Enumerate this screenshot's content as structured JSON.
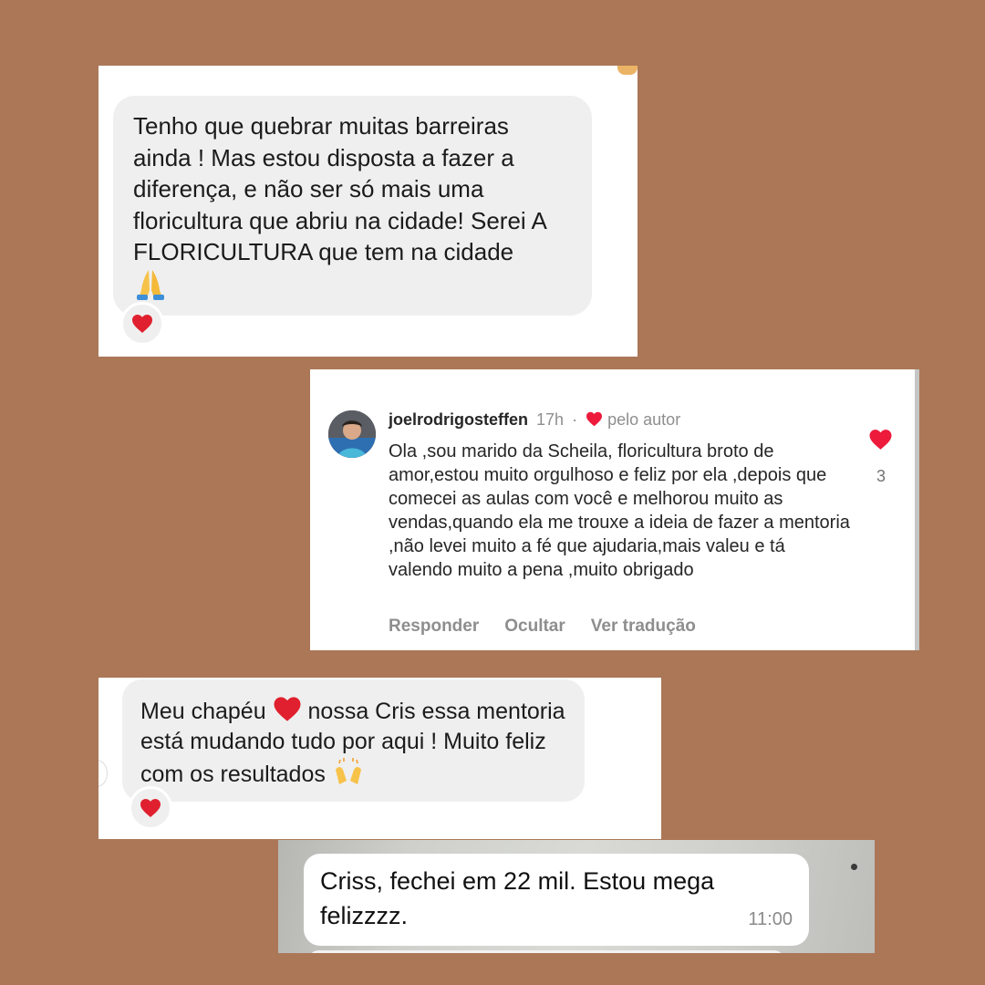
{
  "card1": {
    "message": "Tenho que quebrar muitas barreiras ainda ! Mas estou disposta a fazer a diferença, e não ser só mais uma floricultura que abriu na cidade! Serei A FLORICULTURA que tem na cidade",
    "emoji_icon": "folded-hands-icon",
    "reaction_icon": "red-heart-icon"
  },
  "card2": {
    "username": "joelrodrigosteffen",
    "time": "17h",
    "separator": "·",
    "liked_by_author": "pelo autor",
    "comment": "Ola ,sou marido da Scheila, floricultura broto de amor,estou muito orgulhoso e feliz por ela ,depois que comecei as aulas com você e melhorou muito as vendas,quando ela me trouxe a ideia de fazer a mentoria ,não levei muito a fé que ajudaria,mais valeu e tá valendo muito a pena ,muito obrigado",
    "like_count": "3",
    "actions": {
      "reply": "Responder",
      "hide": "Ocultar",
      "translate": "Ver tradução"
    },
    "colors": {
      "heart": "#ed1a3b",
      "muted": "#8e8e8e"
    }
  },
  "card3": {
    "text_before_emoji": "Meu chapéu",
    "text_after_emoji": "nossa Cris essa mentoria está mudando tudo por aqui ! Muito feliz com os resultados",
    "inline_emoji_icon": "red-heart-icon",
    "end_emoji_icon": "raising-hands-icon",
    "reaction_icon": "red-heart-icon"
  },
  "card4": {
    "message": "Criss, fechei em 22 mil. Estou mega felizzzz.",
    "timestamp": "11:00"
  },
  "colors": {
    "background": "#ab7757",
    "bubble": "#efefef",
    "heart": "#e0202e"
  }
}
